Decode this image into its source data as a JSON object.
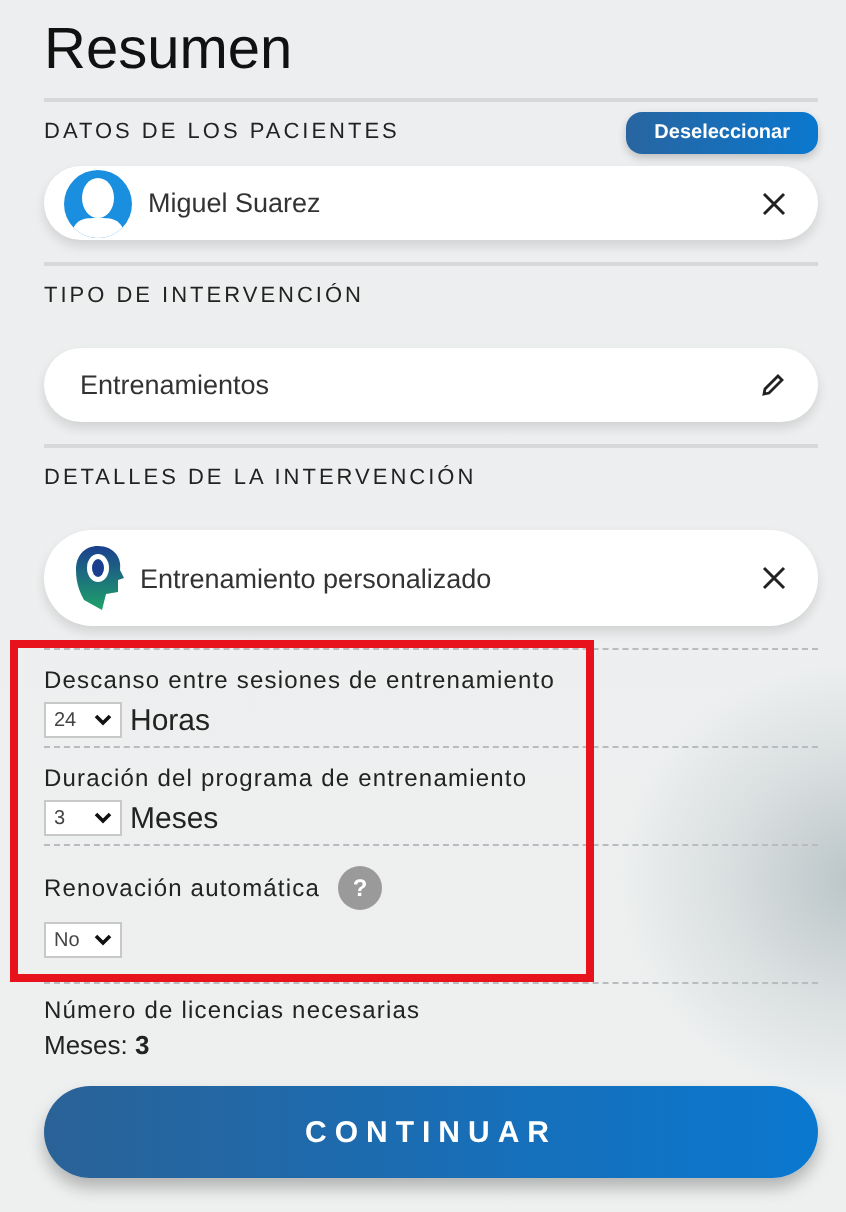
{
  "title": "Resumen",
  "sections": [
    {
      "label": "DATOS DE LOS PACIENTES",
      "action": "Deseleccionar",
      "item": {
        "kind": "patient",
        "text": "Miguel Suarez"
      }
    },
    {
      "label": "TIPO DE INTERVENCIÓN",
      "item": {
        "kind": "type",
        "text": "Entrenamientos"
      }
    },
    {
      "label": "DETALLES DE LA INTERVENCIÓN",
      "item": {
        "kind": "detail",
        "text": "Entrenamiento personalizado"
      }
    }
  ],
  "settings": [
    {
      "label": "Descanso entre sesiones de entrenamiento",
      "value": "24",
      "unit": "Horas"
    },
    {
      "label": "Duración del programa de entrenamiento",
      "value": "3",
      "unit": "Meses"
    },
    {
      "label": "Renovación automática",
      "help": "?",
      "value": "No"
    }
  ],
  "licenses": {
    "label": "Número de licencias necesarias",
    "text": "Meses: **3**"
  },
  "button": "CONTINUAR"
}
